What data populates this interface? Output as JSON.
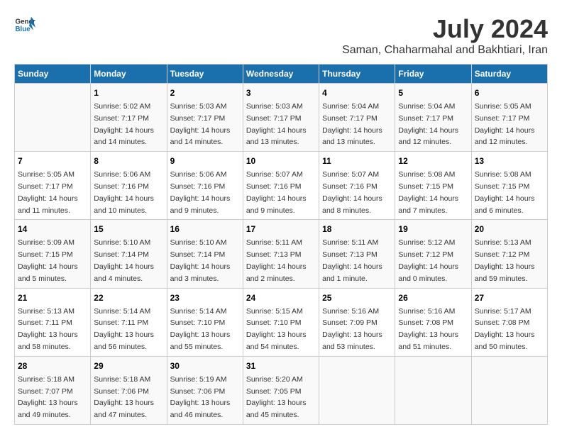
{
  "header": {
    "logo_general": "General",
    "logo_blue": "Blue",
    "month_title": "July 2024",
    "location": "Saman, Chaharmahal and Bakhtiari, Iran"
  },
  "calendar": {
    "weekdays": [
      "Sunday",
      "Monday",
      "Tuesday",
      "Wednesday",
      "Thursday",
      "Friday",
      "Saturday"
    ],
    "weeks": [
      [
        {
          "day": "",
          "info": ""
        },
        {
          "day": "1",
          "info": "Sunrise: 5:02 AM\nSunset: 7:17 PM\nDaylight: 14 hours\nand 14 minutes."
        },
        {
          "day": "2",
          "info": "Sunrise: 5:03 AM\nSunset: 7:17 PM\nDaylight: 14 hours\nand 14 minutes."
        },
        {
          "day": "3",
          "info": "Sunrise: 5:03 AM\nSunset: 7:17 PM\nDaylight: 14 hours\nand 13 minutes."
        },
        {
          "day": "4",
          "info": "Sunrise: 5:04 AM\nSunset: 7:17 PM\nDaylight: 14 hours\nand 13 minutes."
        },
        {
          "day": "5",
          "info": "Sunrise: 5:04 AM\nSunset: 7:17 PM\nDaylight: 14 hours\nand 12 minutes."
        },
        {
          "day": "6",
          "info": "Sunrise: 5:05 AM\nSunset: 7:17 PM\nDaylight: 14 hours\nand 12 minutes."
        }
      ],
      [
        {
          "day": "7",
          "info": "Sunrise: 5:05 AM\nSunset: 7:17 PM\nDaylight: 14 hours\nand 11 minutes."
        },
        {
          "day": "8",
          "info": "Sunrise: 5:06 AM\nSunset: 7:16 PM\nDaylight: 14 hours\nand 10 minutes."
        },
        {
          "day": "9",
          "info": "Sunrise: 5:06 AM\nSunset: 7:16 PM\nDaylight: 14 hours\nand 9 minutes."
        },
        {
          "day": "10",
          "info": "Sunrise: 5:07 AM\nSunset: 7:16 PM\nDaylight: 14 hours\nand 9 minutes."
        },
        {
          "day": "11",
          "info": "Sunrise: 5:07 AM\nSunset: 7:16 PM\nDaylight: 14 hours\nand 8 minutes."
        },
        {
          "day": "12",
          "info": "Sunrise: 5:08 AM\nSunset: 7:15 PM\nDaylight: 14 hours\nand 7 minutes."
        },
        {
          "day": "13",
          "info": "Sunrise: 5:08 AM\nSunset: 7:15 PM\nDaylight: 14 hours\nand 6 minutes."
        }
      ],
      [
        {
          "day": "14",
          "info": "Sunrise: 5:09 AM\nSunset: 7:15 PM\nDaylight: 14 hours\nand 5 minutes."
        },
        {
          "day": "15",
          "info": "Sunrise: 5:10 AM\nSunset: 7:14 PM\nDaylight: 14 hours\nand 4 minutes."
        },
        {
          "day": "16",
          "info": "Sunrise: 5:10 AM\nSunset: 7:14 PM\nDaylight: 14 hours\nand 3 minutes."
        },
        {
          "day": "17",
          "info": "Sunrise: 5:11 AM\nSunset: 7:13 PM\nDaylight: 14 hours\nand 2 minutes."
        },
        {
          "day": "18",
          "info": "Sunrise: 5:11 AM\nSunset: 7:13 PM\nDaylight: 14 hours\nand 1 minute."
        },
        {
          "day": "19",
          "info": "Sunrise: 5:12 AM\nSunset: 7:12 PM\nDaylight: 14 hours\nand 0 minutes."
        },
        {
          "day": "20",
          "info": "Sunrise: 5:13 AM\nSunset: 7:12 PM\nDaylight: 13 hours\nand 59 minutes."
        }
      ],
      [
        {
          "day": "21",
          "info": "Sunrise: 5:13 AM\nSunset: 7:11 PM\nDaylight: 13 hours\nand 58 minutes."
        },
        {
          "day": "22",
          "info": "Sunrise: 5:14 AM\nSunset: 7:11 PM\nDaylight: 13 hours\nand 56 minutes."
        },
        {
          "day": "23",
          "info": "Sunrise: 5:14 AM\nSunset: 7:10 PM\nDaylight: 13 hours\nand 55 minutes."
        },
        {
          "day": "24",
          "info": "Sunrise: 5:15 AM\nSunset: 7:10 PM\nDaylight: 13 hours\nand 54 minutes."
        },
        {
          "day": "25",
          "info": "Sunrise: 5:16 AM\nSunset: 7:09 PM\nDaylight: 13 hours\nand 53 minutes."
        },
        {
          "day": "26",
          "info": "Sunrise: 5:16 AM\nSunset: 7:08 PM\nDaylight: 13 hours\nand 51 minutes."
        },
        {
          "day": "27",
          "info": "Sunrise: 5:17 AM\nSunset: 7:08 PM\nDaylight: 13 hours\nand 50 minutes."
        }
      ],
      [
        {
          "day": "28",
          "info": "Sunrise: 5:18 AM\nSunset: 7:07 PM\nDaylight: 13 hours\nand 49 minutes."
        },
        {
          "day": "29",
          "info": "Sunrise: 5:18 AM\nSunset: 7:06 PM\nDaylight: 13 hours\nand 47 minutes."
        },
        {
          "day": "30",
          "info": "Sunrise: 5:19 AM\nSunset: 7:06 PM\nDaylight: 13 hours\nand 46 minutes."
        },
        {
          "day": "31",
          "info": "Sunrise: 5:20 AM\nSunset: 7:05 PM\nDaylight: 13 hours\nand 45 minutes."
        },
        {
          "day": "",
          "info": ""
        },
        {
          "day": "",
          "info": ""
        },
        {
          "day": "",
          "info": ""
        }
      ]
    ]
  }
}
